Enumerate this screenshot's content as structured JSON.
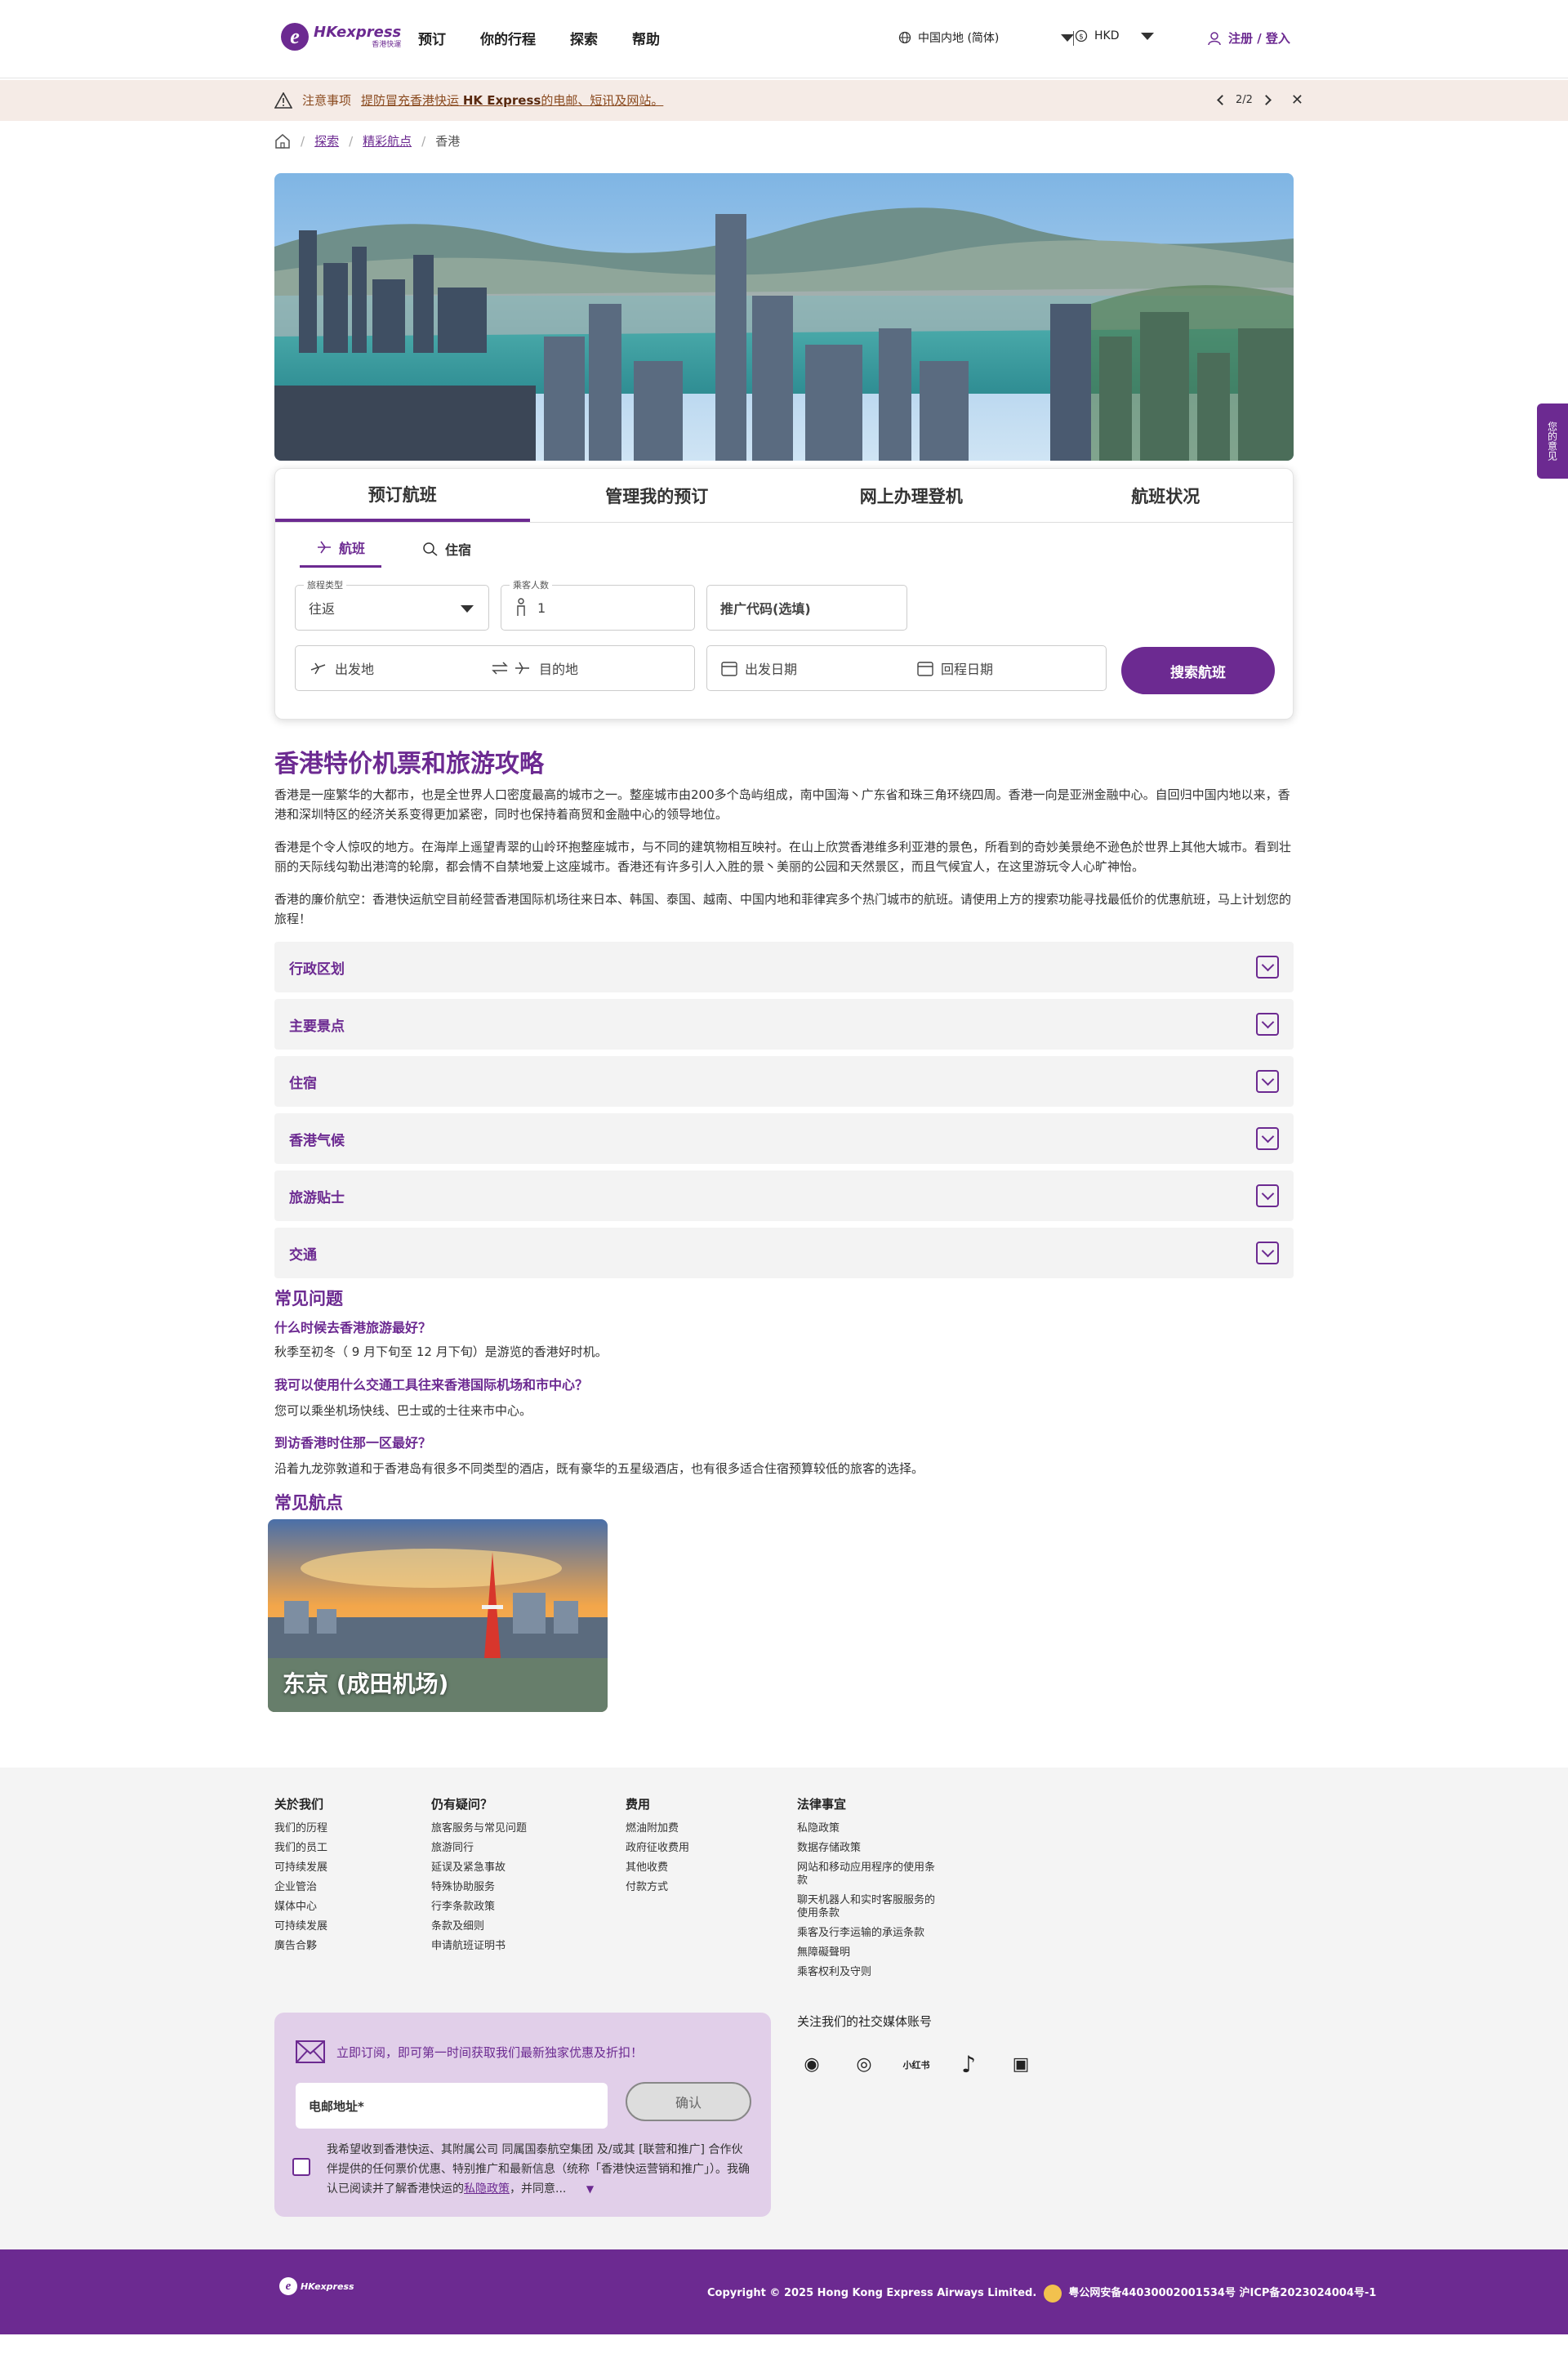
{
  "header": {
    "logo_big": "HKexpress",
    "logo_small": "香港快運",
    "nav": [
      "预订",
      "你的行程",
      "探索",
      "帮助"
    ],
    "region": "中国内地 (简体)",
    "currency": "HKD",
    "login": "注册 / 登入"
  },
  "notice": {
    "label": "注意事项",
    "text_prefix": "提防冒充香港快运",
    "brand": "HK Express",
    "text_suffix": "的电邮、短讯及网站。",
    "pager": "2/2"
  },
  "breadcrumb": {
    "items": [
      "探索",
      "精彩航点"
    ],
    "current": "香港"
  },
  "booking": {
    "tabs": [
      "预订航班",
      "管理我的预订",
      "网上办理登机",
      "航班状况"
    ],
    "subtabs": [
      "航班",
      "住宿"
    ],
    "trip_type_label": "旅程类型",
    "trip_type_value": "往返",
    "passengers_label": "乘客人数",
    "passengers_value": "1",
    "promo_placeholder": "推广代码(选填)",
    "origin_placeholder": "出发地",
    "destination_placeholder": "目的地",
    "depart_placeholder": "出发日期",
    "return_placeholder": "回程日期",
    "search_label": "搜索航班"
  },
  "content": {
    "title": "香港特价机票和旅游攻略",
    "p1": "香港是一座繁华的大都市，也是全世界人口密度最高的城市之一。整座城市由200多个岛屿组成，南中国海丶广东省和珠三角环绕四周。香港一向是亚洲金融中心。自回归中国内地以来，香港和深圳特区的经济关系变得更加紧密，同时也保持着商贸和金融中心的领导地位。",
    "p2": "香港是个令人惊叹的地方。在海岸上遥望青翠的山岭环抱整座城市，与不同的建筑物相互映衬。在山上欣赏香港维多利亚港的景色，所看到的奇妙美景绝不逊色於世界上其他大城市。看到壮丽的天际线勾勒出港湾的轮廓，都会情不自禁地爱上这座城市。香港还有许多引人入胜的景丶美丽的公园和天然景区，而且气候宜人，在这里游玩令人心旷神怡。",
    "p3": "香港的廉价航空：香港快运航空目前经营香港国际机场往来日本、韩国、泰国、越南、中国内地和菲律宾多个热门城市的航班。请使用上方的搜索功能寻找最低价的优惠航班，马上计划您的旅程！",
    "accordions": [
      "行政区划",
      "主要景点",
      "住宿",
      "香港气候",
      "旅游贴士",
      "交通"
    ]
  },
  "faq": {
    "title": "常见问题",
    "q1": "什么时候去香港旅游最好？",
    "a1": "秋季至初冬（ 9 月下旬至 12 月下旬）是游览的香港好时机。",
    "q2": "我可以使用什么交通工具往来香港国际机场和市中心？",
    "a2": "您可以乘坐机场快线、巴士或的士往来市中心。",
    "q3": "到访香港时住那一区最好？",
    "a3": "沿着九龙弥敦道和于香港岛有很多不同类型的酒店，既有豪华的五星级酒店，也有很多适合住宿预算较低的旅客的选择。"
  },
  "popular": {
    "title": "常见航点",
    "card_label": "东京 (成田机场)"
  },
  "footer": {
    "col1": {
      "title": "关於我们",
      "items": [
        "我们的历程",
        "我们的员工",
        "可持续发展",
        "企业管治",
        "媒体中心",
        "可持续发展",
        "廣告合夥"
      ]
    },
    "col2": {
      "title": "仍有疑问？",
      "items": [
        "旅客服务与常见问题",
        "旅游同行",
        "延误及紧急事故",
        "特殊协助服务",
        "行李条款政策",
        "条款及细则",
        "申请航班证明书"
      ]
    },
    "col3": {
      "title": "费用",
      "items": [
        "燃油附加费",
        "政府征收费用",
        "其他收费",
        "付款方式"
      ]
    },
    "col4": {
      "title": "法律事宜",
      "items": [
        "私隐政策",
        "数据存储政策",
        "网站和移动应用程序的使用条款",
        "聊天机器人和实时客服服务的使用条款",
        "乘客及行李运输的承运条款",
        "無障礙聲明",
        "乘客权利及守则"
      ]
    },
    "newsletter_head": "立即订阅，即可第一时间获取我们最新独家优惠及折扣！",
    "email_placeholder": "电邮地址*",
    "confirm": "确认",
    "consent_prefix": "我希望收到香港快运、其附属公司 同属国泰航空集团 及/或其 [联营和推广] 合作伙伴提供的任何票价优惠、特别推广和最新信息（统称「香港快运营销和推广」）。我确认已阅读并了解香港快运的",
    "consent_link": "私隐政策",
    "consent_suffix": "，并同意...",
    "social_label": "关注我们的社交媒体账号",
    "social_icons": [
      "weibo-icon",
      "wechat-icon",
      "xiaohongshu-icon",
      "tiktok-icon",
      "bilibili-icon"
    ],
    "social_glyphs": [
      "◉",
      "◎",
      "小红书",
      "♪",
      "▣"
    ]
  },
  "bottom": {
    "copyright": "Copyright © 2025 Hong Kong Express Airways Limited.",
    "icp": "粤公网安备44030002001534号 沪ICP备2023024004号-1"
  },
  "side_tab": "您的意见"
}
